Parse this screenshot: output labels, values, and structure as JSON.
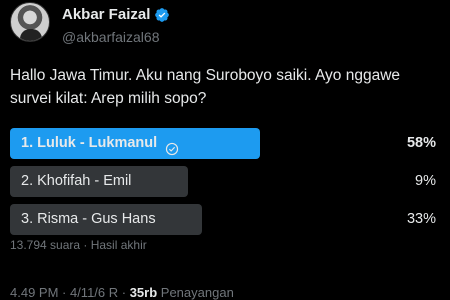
{
  "author": {
    "display_name": "Akbar Faizal",
    "handle": "@akbarfaizal68"
  },
  "tweet": {
    "text": "Hallo Jawa Timur. Aku nang Suroboyo saiki. Ayo nggawe survei kilat: Arep milih sopo?"
  },
  "poll": {
    "options": [
      {
        "label": "1. Luluk - Lukmanul",
        "percent_text": "58%",
        "percent": 58,
        "winner": true
      },
      {
        "label": "2. Khofifah - Emil",
        "percent_text": "9%",
        "percent": 9,
        "winner": false
      },
      {
        "label": "3. Risma - Gus Hans",
        "percent_text": "33%",
        "percent": 33,
        "winner": false
      }
    ],
    "meta": "13.794 suara · Hasil akhir"
  },
  "footer": {
    "time_date": "4.49 PM · 4/11/6 R · ",
    "views_count": "35rb",
    "views_label": " Penayangan"
  },
  "colors": {
    "accent": "#1d9bf0",
    "bar_neutral": "#333639",
    "muted_text": "#71767b"
  }
}
